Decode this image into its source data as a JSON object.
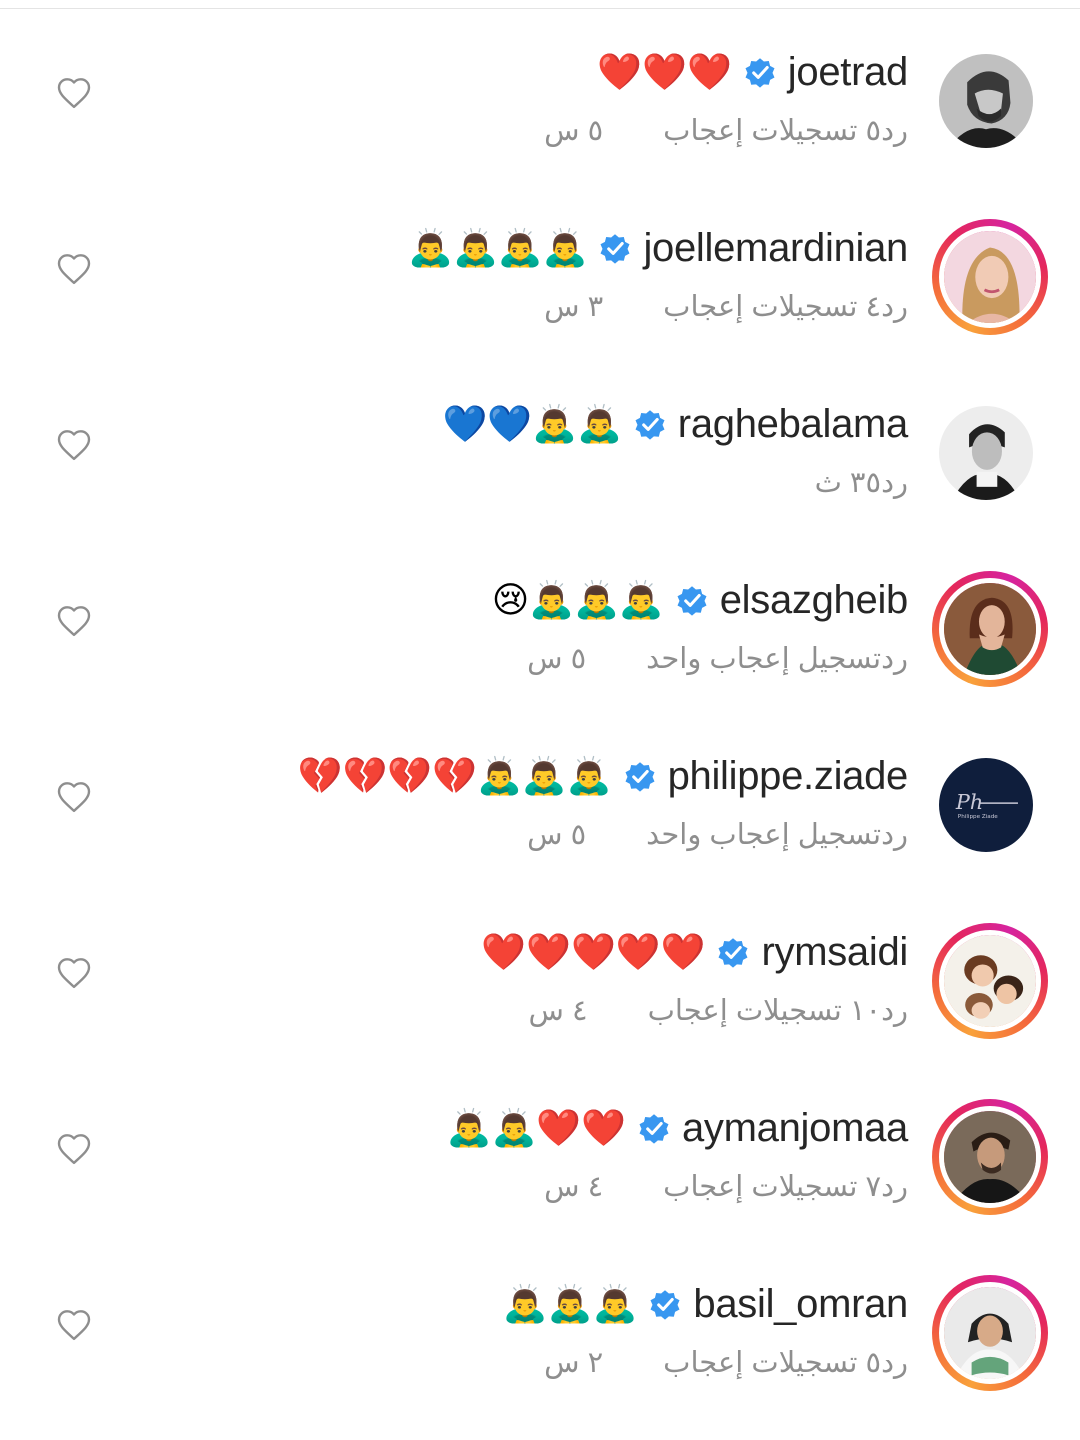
{
  "colors": {
    "verified": "#3897f0",
    "text": "#262626",
    "muted": "#8e8e8e",
    "heart_outline": "#8e8e8e"
  },
  "comments": [
    {
      "username": "joetrad",
      "text": "❤️❤️❤️",
      "time": "٥ س",
      "likes": "٥ تسجيلات إعجاب",
      "reply": "رد",
      "avatar": "bw-man",
      "ring": false
    },
    {
      "username": "joellemardinian",
      "text": "🙇‍♂️🙇‍♂️🙇‍♂️🙇‍♂️",
      "time": "٣ س",
      "likes": "٤ تسجيلات إعجاب",
      "reply": "رد",
      "avatar": "woman-blonde",
      "ring": true
    },
    {
      "username": "raghebalama",
      "text": "💙💙🙇‍♂️🙇‍♂️",
      "time": "٣٥ ث",
      "likes": "",
      "reply": "رد",
      "avatar": "bw-man2",
      "ring": false
    },
    {
      "username": "elsazgheib",
      "text": "😢🙇‍♂️🙇‍♂️🙇‍♂️",
      "time": "٥ س",
      "likes": "تسجيل إعجاب واحد",
      "reply": "رد",
      "avatar": "woman-green",
      "ring": true
    },
    {
      "username": "philippe.ziade",
      "text": "💔💔💔💔🙇‍♂️🙇‍♂️🙇‍♂️",
      "time": "٥ س",
      "likes": "تسجيل إعجاب واحد",
      "reply": "رد",
      "avatar": "logo-navy",
      "ring": false
    },
    {
      "username": "rymsaidi",
      "text": "❤️❤️❤️❤️❤️",
      "time": "٤ س",
      "likes": "١٠ تسجيلات إعجاب",
      "reply": "رد",
      "avatar": "family",
      "ring": true
    },
    {
      "username": "aymanjomaa",
      "text": "🙇‍♂️🙇‍♂️❤️❤️",
      "time": "٤ س",
      "likes": "٧ تسجيلات إعجاب",
      "reply": "رد",
      "avatar": "man-black",
      "ring": true
    },
    {
      "username": "basil_omran",
      "text": "🙇‍♂️🙇‍♂️🙇‍♂️",
      "time": "٢ س",
      "likes": "٥ تسجيلات إعجاب",
      "reply": "رد",
      "avatar": "man-white",
      "ring": true
    }
  ],
  "icons": {
    "like": "heart-outline-icon",
    "verified": "verified-badge-icon"
  }
}
